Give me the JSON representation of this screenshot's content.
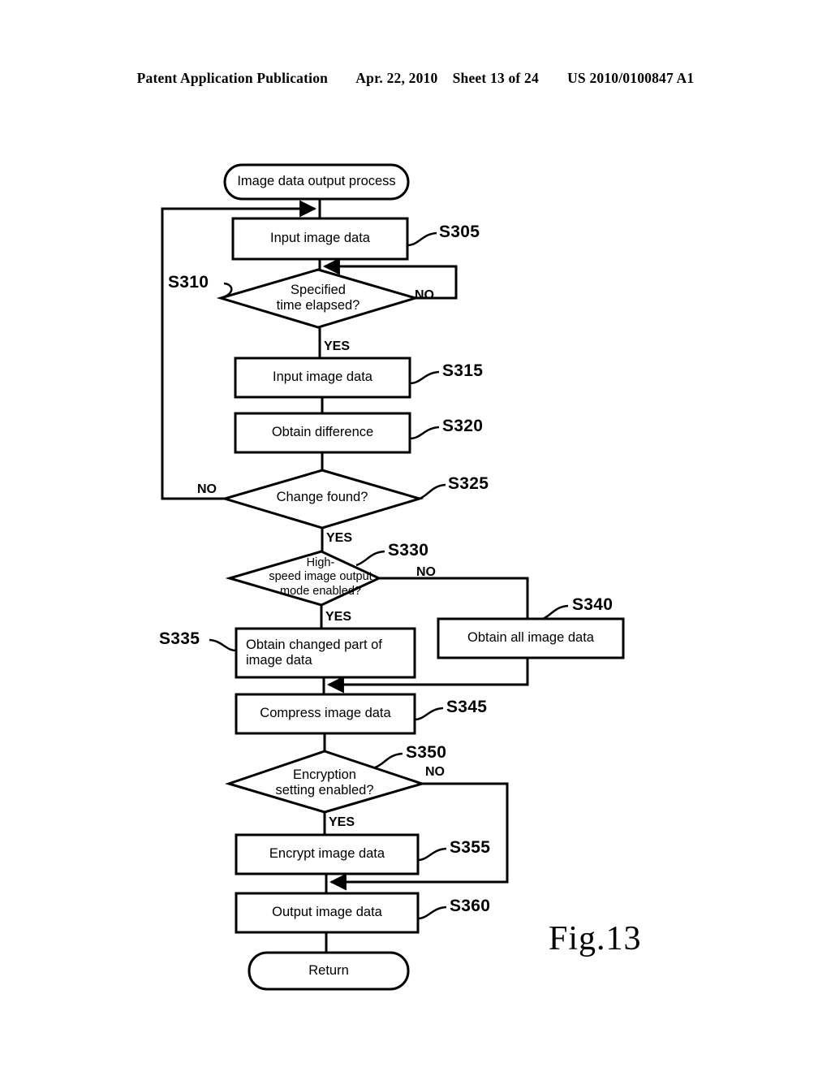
{
  "header": {
    "publication": "Patent Application Publication",
    "date": "Apr. 22, 2010",
    "sheet": "Sheet 13 of 24",
    "patent_number": "US 2010/0100847 A1"
  },
  "figure": {
    "caption": "Fig.13",
    "title": "Image data output process"
  },
  "nodes": {
    "start": {
      "label": "Image data output process",
      "shape": "terminator"
    },
    "s305": {
      "label": "Input image data",
      "shape": "process",
      "step": "S305"
    },
    "s310": {
      "label": "Specified\ntime elapsed?",
      "shape": "decision",
      "step": "S310"
    },
    "s315": {
      "label": "Input image data",
      "shape": "process",
      "step": "S315"
    },
    "s320": {
      "label": "Obtain difference",
      "shape": "process",
      "step": "S320"
    },
    "s325": {
      "label": "Change found?",
      "shape": "decision",
      "step": "S325"
    },
    "s330": {
      "label": "High-\nspeed image output\nmode enabled?",
      "shape": "decision",
      "step": "S330"
    },
    "s335": {
      "label": "Obtain changed part of\nimage data",
      "shape": "process",
      "step": "S335"
    },
    "s340": {
      "label": "Obtain all image data",
      "shape": "process",
      "step": "S340"
    },
    "s345": {
      "label": "Compress image data",
      "shape": "process",
      "step": "S345"
    },
    "s350": {
      "label": "Encryption\nsetting enabled?",
      "shape": "decision",
      "step": "S350"
    },
    "s355": {
      "label": "Encrypt image data",
      "shape": "process",
      "step": "S355"
    },
    "s360": {
      "label": "Output image data",
      "shape": "process",
      "step": "S360"
    },
    "end": {
      "label": "Return",
      "shape": "terminator"
    }
  },
  "branches": {
    "s310_no": "NO",
    "s310_yes": "YES",
    "s325_no": "NO",
    "s325_yes": "YES",
    "s330_no": "NO",
    "s330_yes": "YES",
    "s350_no": "NO",
    "s350_yes": "YES"
  },
  "colors": {
    "ink": "#000000",
    "paper": "#ffffff"
  }
}
